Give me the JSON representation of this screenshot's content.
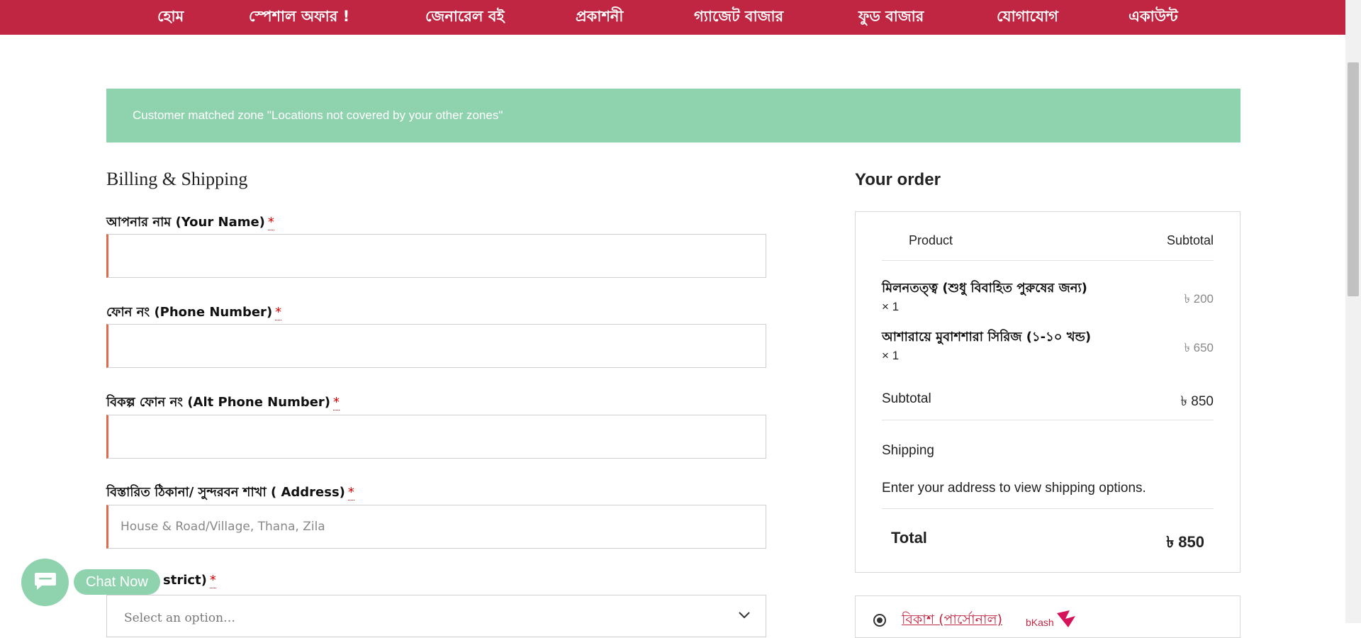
{
  "nav": {
    "items": [
      "হোম",
      "স্পেশাল অফার !",
      "জেনারেল বই",
      "প্রকাশনী",
      "গ্যাজেট বাজার",
      "ফুড বাজার",
      "যোগাযোগ",
      "একাউন্ট"
    ]
  },
  "notice": {
    "text": "Customer matched zone \"Locations not covered by your other zones\""
  },
  "billing": {
    "title": "Billing & Shipping",
    "required_mark": "*",
    "fields": [
      {
        "label": "আপনার নাম (Your Name)",
        "value": "",
        "placeholder": ""
      },
      {
        "label": "ফোন নং (Phone Number)",
        "value": "",
        "placeholder": ""
      },
      {
        "label": "বিকল্প ফোন নং (Alt Phone Number)",
        "value": "",
        "placeholder": ""
      },
      {
        "label": "বিস্তারিত ঠিকানা/ সুন্দরবন শাখা ( Address)",
        "value": "",
        "placeholder": "House & Road/Village, Thana, Zila"
      },
      {
        "label": "strict)",
        "value": "Select an option…"
      }
    ]
  },
  "order": {
    "title": "Your order",
    "col_product": "Product",
    "col_subtotal": "Subtotal",
    "items": [
      {
        "name": "মিলনতত্ত্ব (শুধু বিবাহিত পুরুষের জন্য)",
        "qty": "× 1",
        "price": "৳ 200"
      },
      {
        "name": "আশারায়ে মুবাশশারা সিরিজ (১-১০ খন্ড)",
        "qty": "× 1",
        "price": "৳ 650"
      }
    ],
    "subtotal_label": "Subtotal",
    "subtotal_value": "৳ 850",
    "shipping_label": "Shipping",
    "shipping_message": "Enter your address to view shipping options.",
    "total_label": "Total",
    "total_value": "৳ 850"
  },
  "payment": {
    "method_label": "বিকাশ (পার্সোনাল)",
    "logo": "bkash-logo"
  },
  "chat": {
    "label": "Chat Now",
    "icon": "chat-icon"
  },
  "colors": {
    "brand": "#c02542",
    "notice_bg": "#8fd3ae",
    "required": "#dd0000",
    "input_accent": "#e06b4a"
  }
}
